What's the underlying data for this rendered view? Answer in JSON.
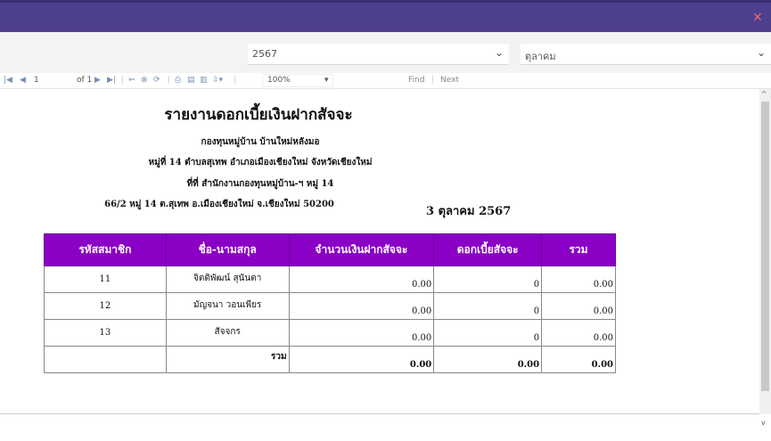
{
  "window": {
    "close_icon": "close-icon"
  },
  "filters": {
    "year": "2567",
    "month": "ตุลาคม"
  },
  "toolbar": {
    "page_current": "1",
    "page_of": "of 1",
    "zoom": "100%",
    "find_label": "Find",
    "next_label": "Next"
  },
  "report": {
    "title": "รายงานดอกเบี้ยเงินฝากสัจจะ",
    "org": "กองทุนหมู่บ้าน บ้านใหม่หลังมอ",
    "address1": "หมู่ที่ 14 ตำบลสุเทพ อำเภอเมืองเชียงใหม่ จังหวัดเชียงใหม่",
    "office": "ที่ที่ สำนักงานกองทุนหมู่บ้าน-ฯ หมู่ 14",
    "address2": "66/2 หมู่ 14 ต.สุเทพ อ.เมืองเชียงใหม่ จ.เชียงใหม่ 50200",
    "date": "3 ตุลาคม 2567",
    "columns": [
      "รหัสสมาชิก",
      "ชื่อ-นามสกุล",
      "จำนวนเงินฝากสัจจะ",
      "ดอกเบี้ยสัจจะ",
      "รวม"
    ],
    "rows": [
      {
        "id": "11",
        "name": "จิตติพัฒน์ สุนันตา",
        "deposit": "0.00",
        "interest": "0",
        "total": "0.00"
      },
      {
        "id": "12",
        "name": "มัญจนา วอนเพียร",
        "deposit": "0.00",
        "interest": "0",
        "total": "0.00"
      },
      {
        "id": "13",
        "name": "สัจจกร",
        "deposit": "0.00",
        "interest": "0",
        "total": "0.00"
      }
    ],
    "total_row": {
      "label": "รวม",
      "deposit": "0.00",
      "interest": "0.00",
      "total": "0.00"
    }
  }
}
